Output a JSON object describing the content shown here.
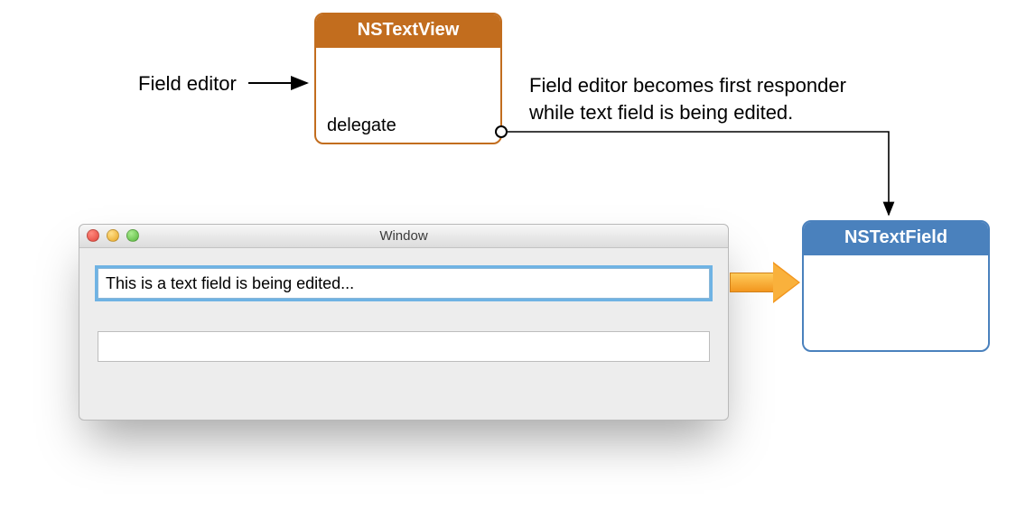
{
  "diagram": {
    "nstextview_title": "NSTextView",
    "nstextfield_title": "NSTextField",
    "delegate_label": "delegate",
    "field_editor_label": "Field editor",
    "description_line1": "Field editor becomes first responder",
    "description_line2": "while text field is being edited."
  },
  "window": {
    "title": "Window",
    "field1_value": "This is a text field is being edited...",
    "field2_value": ""
  },
  "colors": {
    "nstextview_border": "#c26d1e",
    "nstextfield_border": "#4a81bd",
    "orange_arrow": "#f2961e"
  }
}
